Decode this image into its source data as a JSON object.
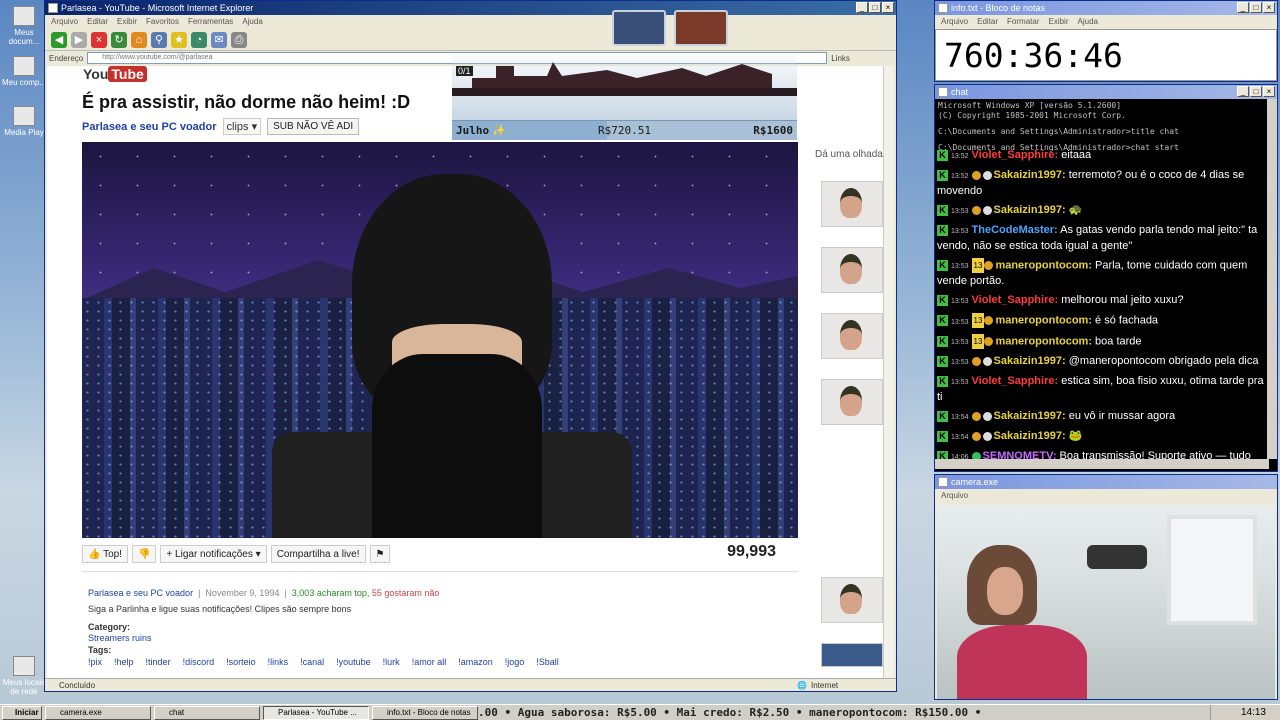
{
  "desktop": {
    "icons": [
      {
        "label": "Meus docum...",
        "icon": "folder-icon"
      },
      {
        "label": "Meu comp...",
        "icon": "computer-icon"
      },
      {
        "label": "Media Play",
        "icon": "media-player-icon"
      },
      {
        "label": "Meus locais de rede",
        "icon": "network-icon"
      }
    ]
  },
  "ie": {
    "title": "Parlasea - YouTube - Microsoft Internet Explorer",
    "menu": [
      "Arquivo",
      "Editar",
      "Exibir",
      "Favoritos",
      "Ferramentas",
      "Ajuda"
    ],
    "address_label": "Endereço",
    "address": "http://www.youtube.com/@parlasea",
    "links_label": "Links",
    "status_left": "Concluído",
    "status_zone": "Internet"
  },
  "youtube": {
    "logo_you": "You",
    "logo_tube": "Tube",
    "video_title": "É pra assistir, não dorme não heim! :D",
    "channel": "Parlasea e seu PC voador",
    "clips_label": "clips",
    "subscribe_label": "SUB NÃO VÊ ADI",
    "like_label": "Top!",
    "notify_label": "Ligar notificações",
    "share_label": "Compartilha a live!",
    "views": "99,993",
    "desc": {
      "channel": "Parlasea e seu PC voador",
      "date": "November 9, 1994",
      "likes_text": "3,003 acharam top,",
      "dislikes_text": "55 gostaram não",
      "text": "Siga a Parlinha e ligue suas notificações! Clipes são sempre bons",
      "category_label": "Category:",
      "category": "Streamers ruins",
      "tags_label": "Tags:",
      "tags": [
        "!pix",
        "!help",
        "!tinder",
        "!discord",
        "!sorteio",
        "!links",
        "!canal",
        "!youtube",
        "!lurk",
        "!amor all",
        "!amazon",
        "!jogo",
        "!Sball"
      ]
    },
    "sidebar_label": "Dá uma olhada",
    "thumbs": 8
  },
  "game_overlay": {
    "hp_text": "0/1",
    "month": "Julho",
    "current_money": "R$720.51",
    "goal_money": "R$1600",
    "goal_progress": 0.45
  },
  "notepad": {
    "title": "info.txt - Bloco de notas",
    "menu": [
      "Arquivo",
      "Editar",
      "Formatar",
      "Exibir",
      "Ajuda"
    ],
    "content": "760:36:46"
  },
  "chat_window": {
    "title": "chat",
    "console_lines": [
      "Microsoft Windows XP [versão 5.1.2600]",
      "(C) Copyright 1985-2001 Microsoft Corp.",
      "",
      "C:\\Documents and Settings\\Administrador>title chat",
      "",
      "C:\\Documents and Settings\\Administrador>chat start"
    ],
    "messages": [
      {
        "time": "13:52",
        "user": "Violet_Sapphire",
        "color": "#ff3b3b",
        "badges": "",
        "text": "eitaaa"
      },
      {
        "time": "13:52",
        "user": "Sakaizin1997",
        "color": "#e8d23a",
        "badges": "b",
        "text": "terremoto? ou é o coco de 4 dias se movendo"
      },
      {
        "time": "13:53",
        "user": "Sakaizin1997",
        "color": "#e8d23a",
        "badges": "b",
        "text": "🐢"
      },
      {
        "time": "13:53",
        "user": "TheCodeMaster",
        "color": "#4aa3ff",
        "badges": "",
        "text": "As gatas vendo parla tendo mal jeito:\" ta vendo, não se estica toda igual a gente\""
      },
      {
        "time": "13:53",
        "user": "maneropontocom",
        "color": "#e8d23a",
        "badges": "13",
        "text": "Parla, tome cuidado com quem vende portão."
      },
      {
        "time": "13:53",
        "user": "Violet_Sapphire",
        "color": "#ff3b3b",
        "badges": "",
        "text": "melhorou mal jeito xuxu?"
      },
      {
        "time": "13:53",
        "user": "maneropontocom",
        "color": "#e8d23a",
        "badges": "13",
        "text": "é só fachada"
      },
      {
        "time": "13:53",
        "user": "maneropontocom",
        "color": "#e8d23a",
        "badges": "13",
        "text": "boa tarde"
      },
      {
        "time": "13:53",
        "user": "Sakaizin1997",
        "color": "#e8d23a",
        "badges": "b",
        "text": "@maneropontocom obrigado pela dica"
      },
      {
        "time": "13:53",
        "user": "Violet_Sapphire",
        "color": "#ff3b3b",
        "badges": "",
        "text": "estica sim, boa fisio xuxu, otima tarde pra ti"
      },
      {
        "time": "13:54",
        "user": "Sakaizin1997",
        "color": "#e8d23a",
        "badges": "b",
        "text": "eu vô ir mussar agora"
      },
      {
        "time": "13:54",
        "user": "Sakaizin1997",
        "color": "#e8d23a",
        "badges": "b",
        "text": "🐸"
      },
      {
        "time": "14:06",
        "user": "SEMNOMETV",
        "color": "#c46bff",
        "badges": "g",
        "text": "Boa transmissão! Suporte ativo — tudo fluindo? 🚀🚀"
      }
    ]
  },
  "camera": {
    "title": "camera.exe",
    "menu": [
      "Arquivo"
    ]
  },
  "taskbar": {
    "start": "Iniciar",
    "tasks": [
      "camera.exe",
      "chat",
      "Parlasea - YouTube ...",
      "info.txt - Bloco de notas"
    ],
    "ticker": ".00 • Agua saborosa: R$5.00 • Mai credo: R$2.50 • maneropontocom: R$150.00 •",
    "clock": "14:13"
  },
  "colors": {
    "accent": "#0a246a",
    "yt_red": "#c4302b",
    "link": "#1f3fa8"
  }
}
